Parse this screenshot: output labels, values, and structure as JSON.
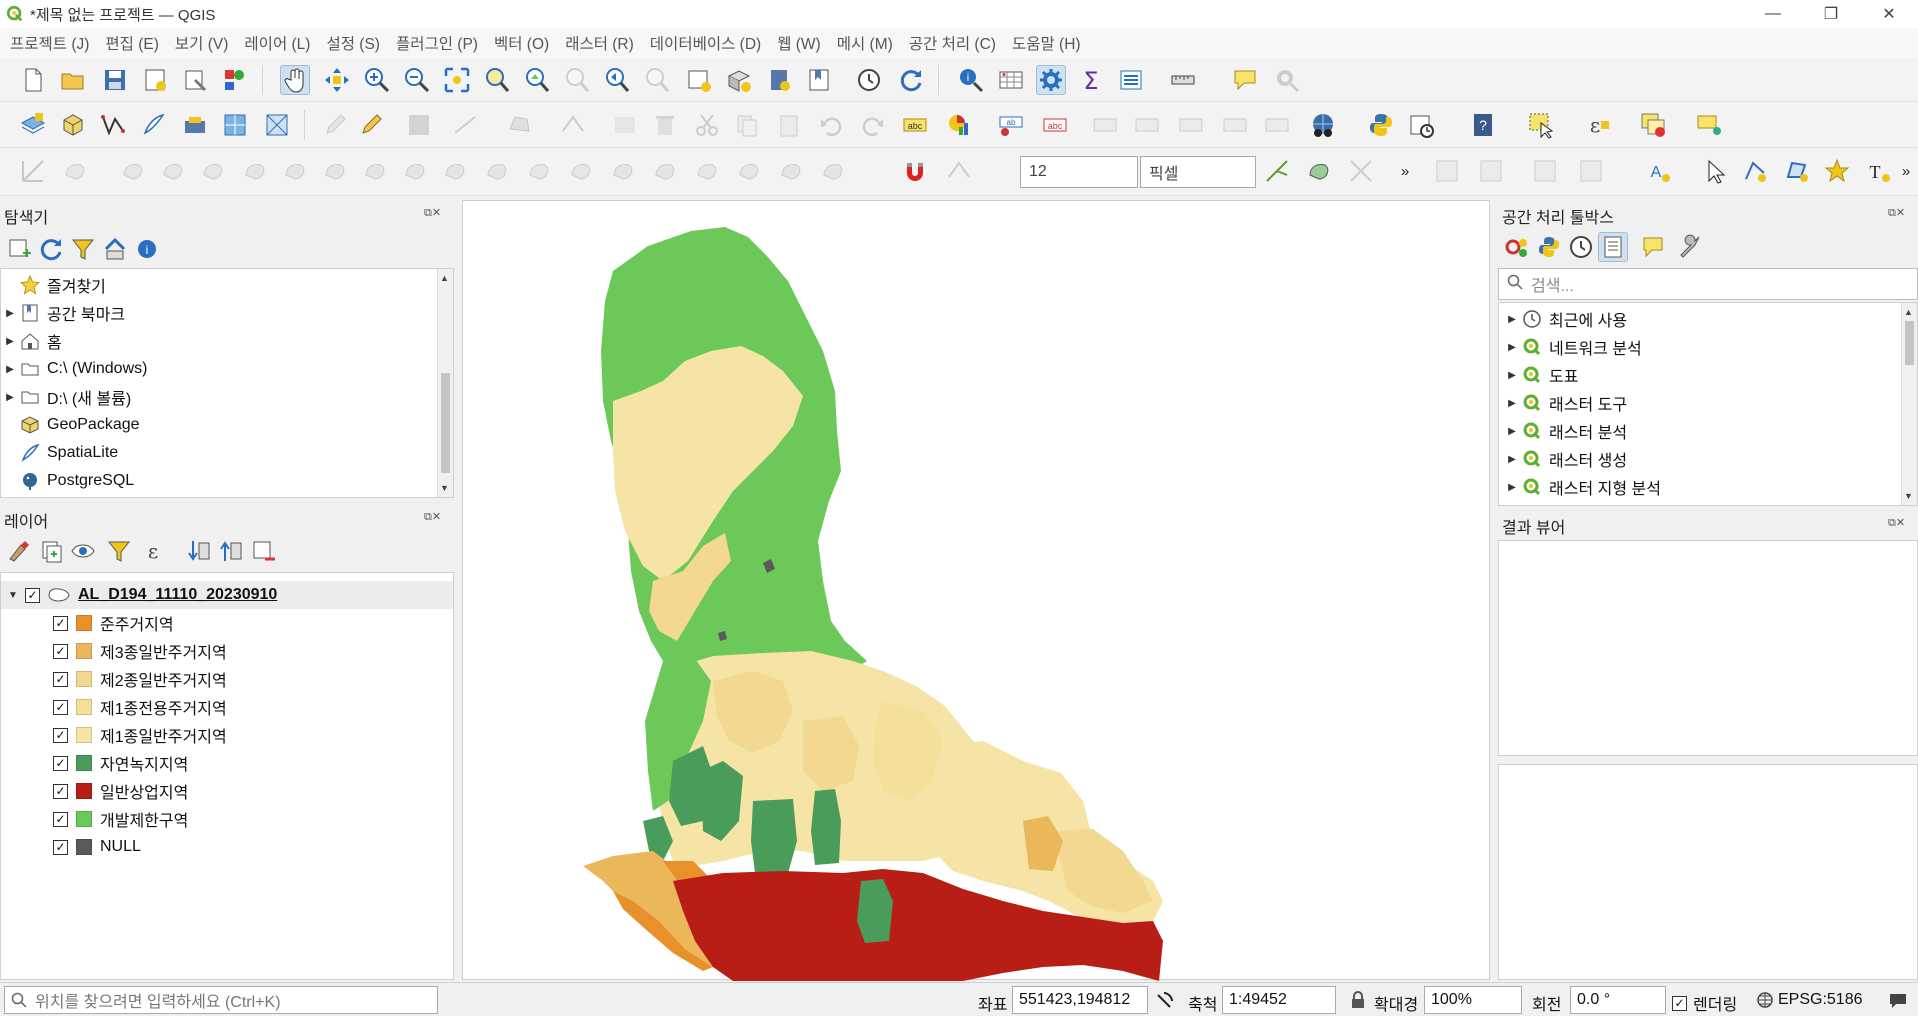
{
  "window": {
    "title": "*제목 없는 프로젝트 — QGIS",
    "minimize": "—",
    "maximize": "❐",
    "close": "✕"
  },
  "menu": [
    "프로젝트 (J)",
    "편집 (E)",
    "보기 (V)",
    "레이어 (L)",
    "설정 (S)",
    "플러그인 (P)",
    "벡터 (O)",
    "래스터 (R)",
    "데이터베이스 (D)",
    "웹 (W)",
    "메시 (M)",
    "공간 처리 (C)",
    "도움말 (H)"
  ],
  "toolbar": {
    "symbol_size": "12",
    "unit": "픽셀",
    "more": "»"
  },
  "browser": {
    "title": "탐색기",
    "items": [
      {
        "label": "즐겨찾기",
        "icon": "star-icon"
      },
      {
        "label": "공간 북마크",
        "icon": "bookmark-icon"
      },
      {
        "label": "홈",
        "icon": "home-icon"
      },
      {
        "label": "C:\\ (Windows)",
        "icon": "folder-icon"
      },
      {
        "label": "D:\\ (새 볼륨)",
        "icon": "folder-icon"
      },
      {
        "label": "GeoPackage",
        "icon": "geopackage-icon"
      },
      {
        "label": "SpatiaLite",
        "icon": "spatialite-icon"
      },
      {
        "label": "PostgreSQL",
        "icon": "postgresql-icon"
      }
    ]
  },
  "layers": {
    "title": "레이어",
    "group": "AL_D194_11110_20230910",
    "items": [
      {
        "label": "준주거지역",
        "color": "#e8902a"
      },
      {
        "label": "제3종일반주거지역",
        "color": "#eab75a"
      },
      {
        "label": "제2종일반주거지역",
        "color": "#f2d890"
      },
      {
        "label": "제1종전용주거지역",
        "color": "#f4e09a"
      },
      {
        "label": "제1종일반주거지역",
        "color": "#f5e4a6"
      },
      {
        "label": "자연녹지지역",
        "color": "#4a9c5a"
      },
      {
        "label": "일반상업지역",
        "color": "#b81e16"
      },
      {
        "label": "개발제한구역",
        "color": "#6cc858"
      },
      {
        "label": "NULL",
        "color": "#5a5a5a"
      }
    ]
  },
  "processing": {
    "title": "공간 처리 툴박스",
    "search_placeholder": "검색...",
    "items": [
      "최근에 사용",
      "네트워크 분석",
      "도표",
      "래스터 도구",
      "래스터 분석",
      "래스터 생성",
      "래스터 지형 분석"
    ]
  },
  "results": {
    "title": "결과 뷰어"
  },
  "status": {
    "locator_placeholder": "위치를 찾으려면 입력하세요 (Ctrl+K)",
    "coord_label": "좌표",
    "coord_value": "551423,194812",
    "scale_label": "축척",
    "scale_value": "1:49452",
    "magnifier_label": "확대경",
    "magnifier_value": "100%",
    "rotation_label": "회전",
    "rotation_value": "0.0 °",
    "render_label": "렌더링",
    "crs": "EPSG:5186"
  }
}
